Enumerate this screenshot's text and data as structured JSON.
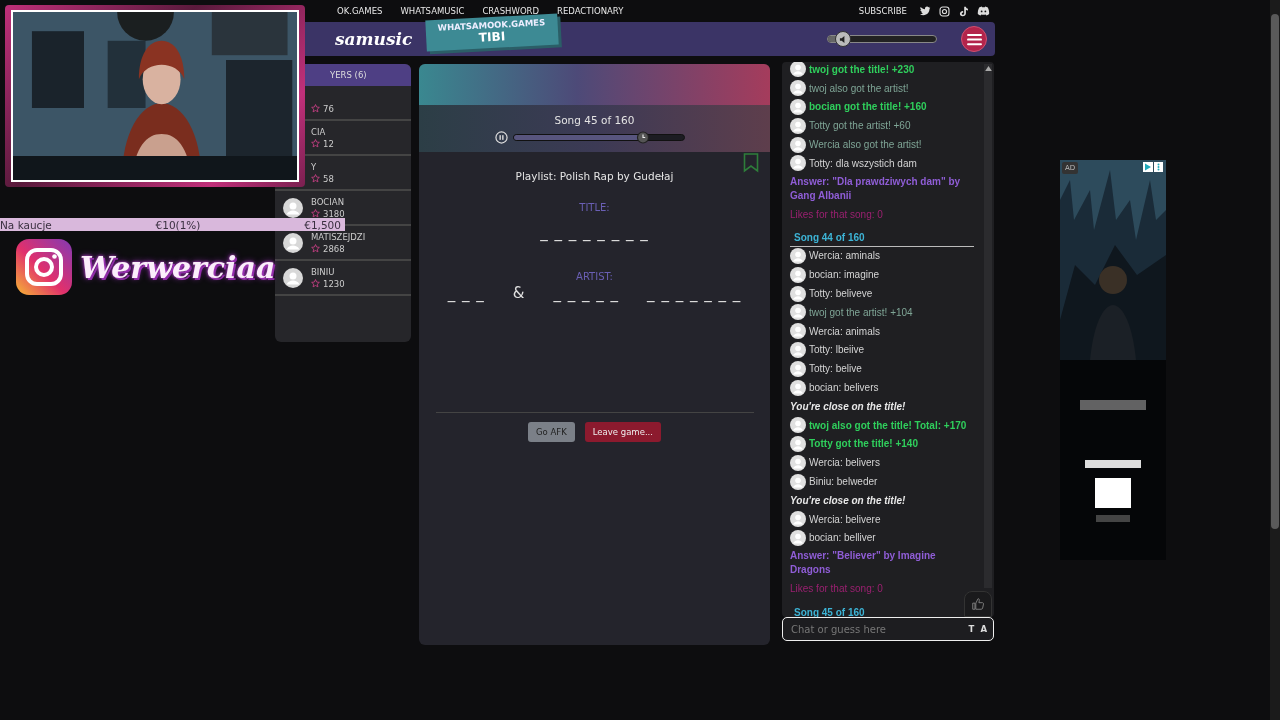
{
  "nav": {
    "links": [
      "OK.GAMES",
      "WHATSAMUSIC",
      "CRASHWORD",
      "REDACTIONARY"
    ],
    "subscribe": "SUBSCRIBE"
  },
  "header": {
    "logo": "samusic",
    "badge_top": "WHATSAMOOK.GAMES",
    "badge_name": "TIBI",
    "volume": {
      "level": 0.13
    }
  },
  "players": {
    "title": "YERS (6)",
    "rows": [
      {
        "score": "76"
      },
      {
        "name": "CIA",
        "score": "12"
      },
      {
        "name": "Y",
        "score": "58"
      },
      {
        "name": "BOCIAN",
        "score": "3180"
      },
      {
        "name": "MATISZEJDZI",
        "score": "2868"
      },
      {
        "name": "BINIU",
        "score": "1230"
      }
    ]
  },
  "game": {
    "song": "Song 45 of 160",
    "progress": {
      "level": 0.76
    },
    "playlist": "Playlist: Polish Rap by Gudełaj",
    "title_label": "TITLE:",
    "title_blanks": "_ _ _ _ _ _ _ _",
    "artist_label": "ARTIST:",
    "artist_parts": [
      "_ _ _",
      "&",
      "_ _ _ _ _",
      "_ _ _ _ _ _ _"
    ],
    "buttons": [
      {
        "label": "Go AFK",
        "kind": "neutral"
      },
      {
        "label": "Leave game...",
        "kind": "danger"
      }
    ]
  },
  "chat": {
    "messages": [
      {
        "kind": "event",
        "text": "twoj got the title! +230"
      },
      {
        "kind": "info",
        "text": "twoj also got the artist!"
      },
      {
        "kind": "event",
        "text": "bocian got the title! +160"
      },
      {
        "kind": "info",
        "text": "Totty got the artist! +60"
      },
      {
        "kind": "info",
        "text": "Wercia also got the artist!"
      },
      {
        "kind": "chat",
        "text": "Totty: dla wszystich dam"
      },
      {
        "kind": "answer",
        "text": "Answer: \"Dla prawdziwych dam\" by Gang Albanii"
      },
      {
        "kind": "likes",
        "text": "Likes for that song: 0"
      },
      {
        "kind": "song",
        "text": "Song 44 of 160"
      },
      {
        "kind": "chat",
        "text": "Wercia: aminals"
      },
      {
        "kind": "chat",
        "text": "bocian: imagine"
      },
      {
        "kind": "chat",
        "text": "Totty: beliveve"
      },
      {
        "kind": "info",
        "text": "twoj got the artist! +104"
      },
      {
        "kind": "chat",
        "text": "Wercia: animals"
      },
      {
        "kind": "chat",
        "text": "Totty: lbeiive"
      },
      {
        "kind": "chat",
        "text": "Totty: belive"
      },
      {
        "kind": "chat",
        "text": "bocian: belivers"
      },
      {
        "kind": "close",
        "text": "You're close on the title!"
      },
      {
        "kind": "event",
        "text": "twoj also got the title! Total: +170"
      },
      {
        "kind": "event",
        "text": "Totty got the title! +140"
      },
      {
        "kind": "chat",
        "text": "Wercia: belivers"
      },
      {
        "kind": "chat",
        "text": "Biniu: belweder"
      },
      {
        "kind": "close",
        "text": "You're close on the title!"
      },
      {
        "kind": "chat",
        "text": "Wercia: belivere"
      },
      {
        "kind": "chat",
        "text": "bocian: belliver"
      },
      {
        "kind": "answer",
        "text": "Answer: \"Believer\" by Imagine Dragons"
      },
      {
        "kind": "likes",
        "text": "Likes for that song: 0"
      },
      {
        "kind": "song",
        "text": "Song 45 of 160"
      }
    ],
    "placeholder": "Chat or guess here",
    "input_buttons": [
      "T",
      "A"
    ]
  },
  "ad": {
    "label": "AD"
  },
  "overlay": {
    "bar": [
      "Na kaucje",
      "€10(1%)",
      "€1,500"
    ],
    "instagram": "Werwerciaa"
  }
}
